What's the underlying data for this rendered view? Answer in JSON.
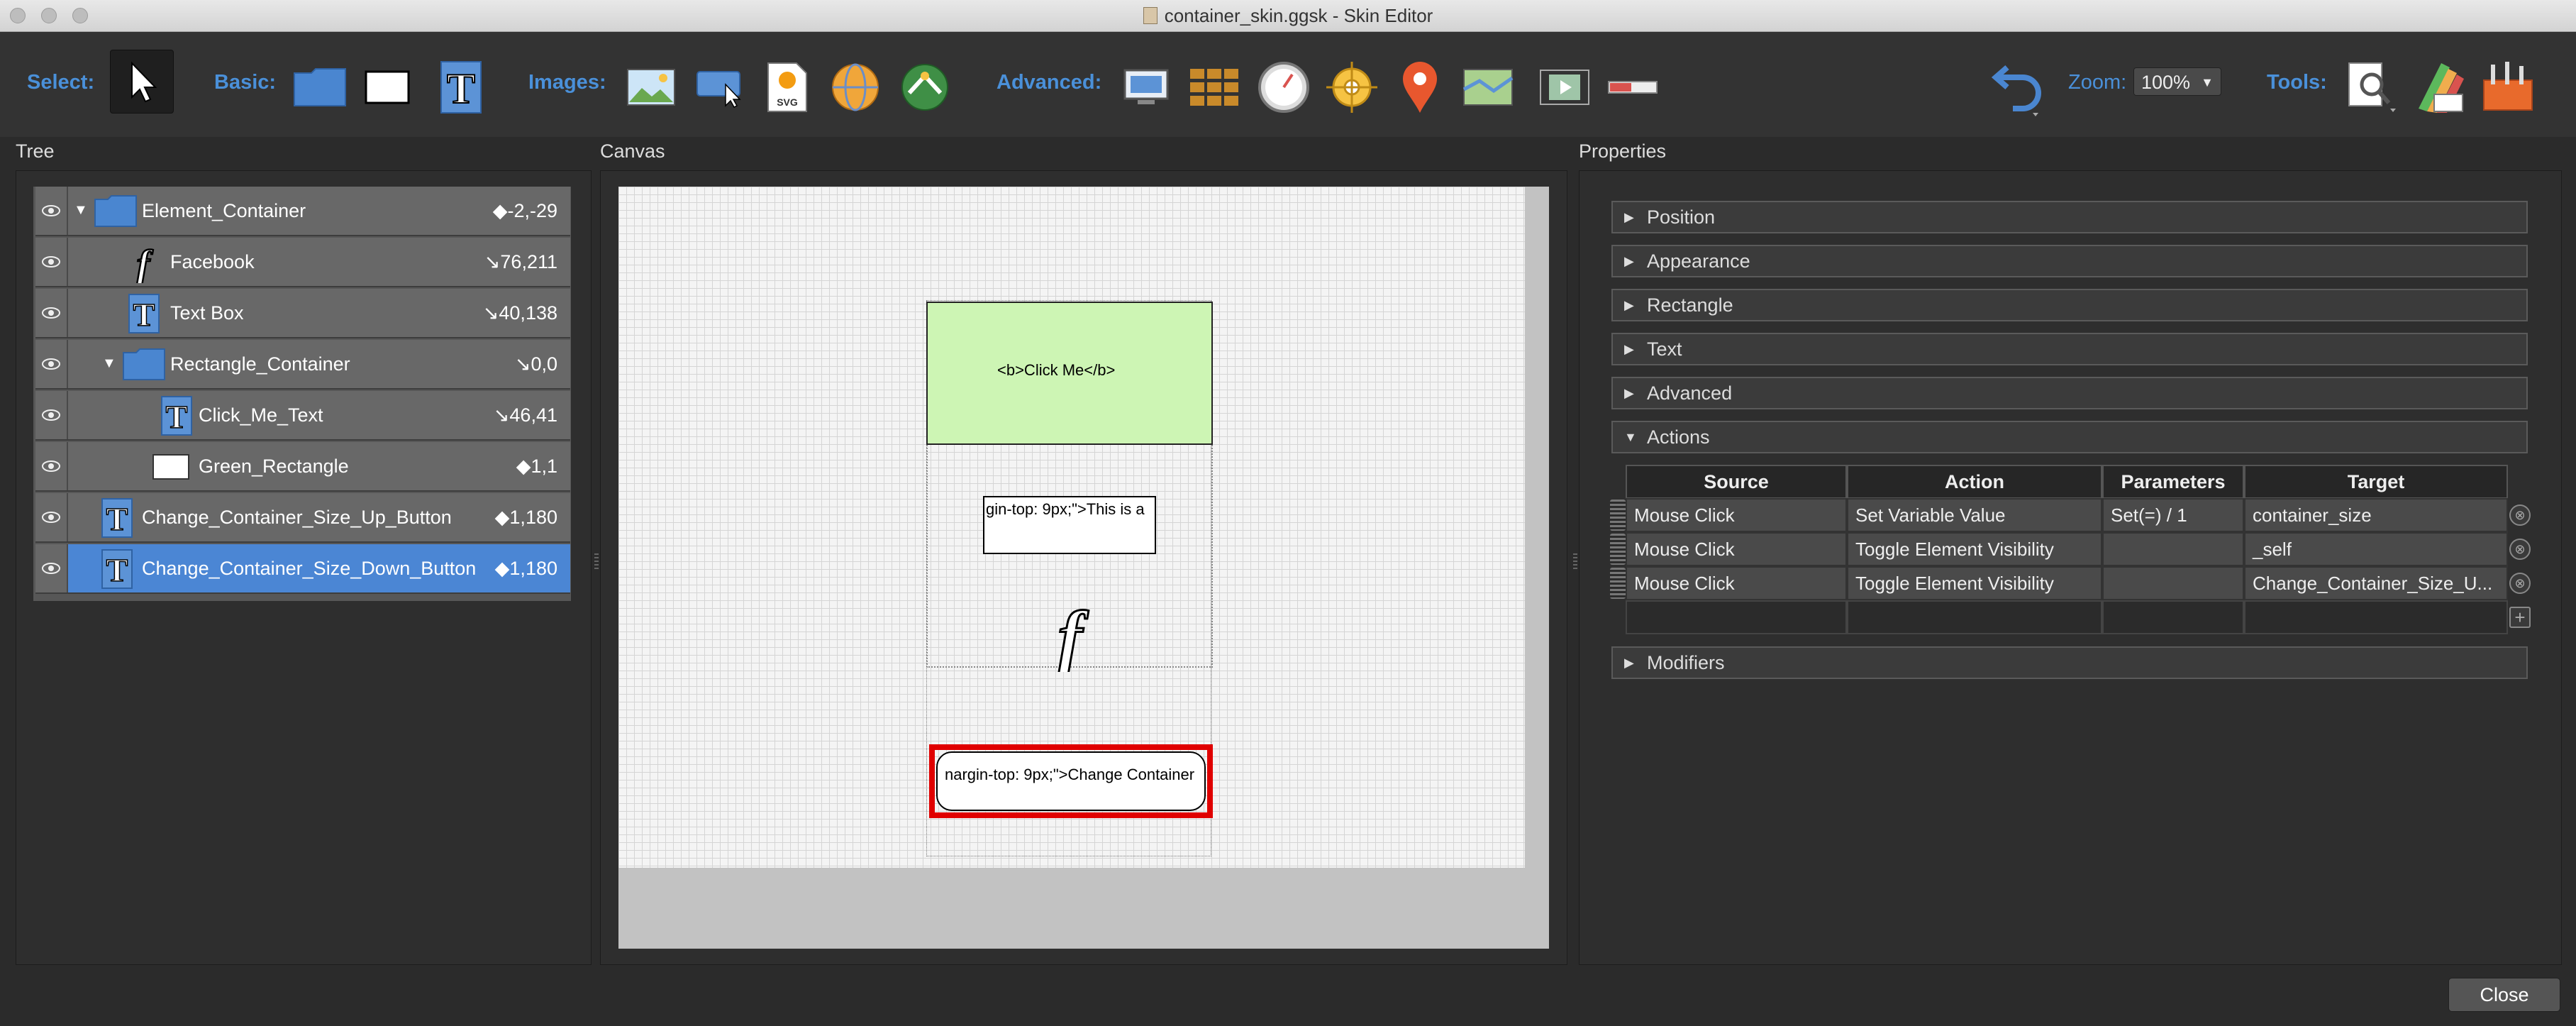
{
  "window": {
    "title": "container_skin.ggsk - Skin Editor"
  },
  "toolbar": {
    "select_label": "Select:",
    "basic_label": "Basic:",
    "images_label": "Images:",
    "svg_label": "SVG",
    "advanced_label": "Advanced:",
    "zoom_label": "Zoom:",
    "zoom_value": "100%",
    "tools_label": "Tools:"
  },
  "tree": {
    "title": "Tree",
    "rows": [
      {
        "label": "Element_Container",
        "coord": "◆-2,-29",
        "icon": "folder-icon"
      },
      {
        "label": "Facebook",
        "coord": "↘76,211",
        "icon": "facebook-image-icon"
      },
      {
        "label": "Text Box",
        "coord": "↘40,138",
        "icon": "text-icon"
      },
      {
        "label": "Rectangle_Container",
        "coord": "↘0,0",
        "icon": "folder-icon"
      },
      {
        "label": "Click_Me_Text",
        "coord": "↘46,41",
        "icon": "text-icon"
      },
      {
        "label": "Green_Rectangle",
        "coord": "◆1,1",
        "icon": "rectangle-icon"
      },
      {
        "label": "Change_Container_Size_Up_Button",
        "coord": "◆1,180",
        "icon": "text-icon"
      },
      {
        "label": "Change_Container_Size_Down_Button",
        "coord": "◆1,180",
        "icon": "text-icon"
      }
    ]
  },
  "canvas": {
    "title": "Canvas",
    "click_me_text": "<b>Click Me</b>",
    "textbox_text": "gin-top: 9px;\">This is a",
    "button_text": "nargin-top: 9px;\">Change Container"
  },
  "properties": {
    "title": "Properties",
    "sections": {
      "position": "Position",
      "appearance": "Appearance",
      "rectangle": "Rectangle",
      "text": "Text",
      "advanced": "Advanced",
      "actions": "Actions",
      "modifiers": "Modifiers"
    },
    "actions_table": {
      "headers": [
        "Source",
        "Action",
        "Parameters",
        "Target"
      ],
      "rows": [
        [
          "Mouse Click",
          "Set Variable Value",
          "Set(=) / 1",
          "container_size"
        ],
        [
          "Mouse Click",
          "Toggle Element Visibility",
          "",
          "_self"
        ],
        [
          "Mouse Click",
          "Toggle Element Visibility",
          "",
          "Change_Container_Size_U..."
        ]
      ],
      "add_symbol": "+",
      "remove_symbol": "⊗"
    }
  },
  "footer": {
    "close_label": "Close"
  },
  "colors": {
    "accent": "#4a90d9",
    "selection": "#4b86d4",
    "green_rect": "#cdf5b4",
    "button_border": "#e00000"
  }
}
